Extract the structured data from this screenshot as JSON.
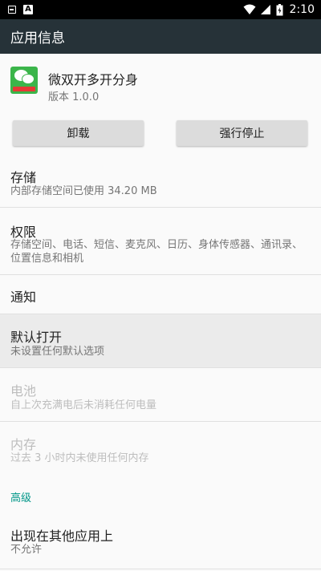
{
  "status_bar": {
    "time": "2:10",
    "icons": [
      "notification-icon",
      "font-icon",
      "wifi-icon",
      "signal-icon",
      "battery-icon"
    ]
  },
  "app_bar": {
    "title": "应用信息"
  },
  "app": {
    "name": "微双开多开分身",
    "version": "版本 1.0.0",
    "icon": "wechat-clone-icon"
  },
  "buttons": {
    "uninstall": "卸载",
    "force_stop": "强行停止"
  },
  "items": {
    "storage": {
      "title": "存储",
      "sub": "内部存储空间已使用 34.20 MB"
    },
    "permissions": {
      "title": "权限",
      "sub": "存储空间、电话、短信、麦克风、日历、身体传感器、通讯录、位置信息和相机"
    },
    "notifications": {
      "title": "通知"
    },
    "open_by_default": {
      "title": "默认打开",
      "sub": "未设置任何默认选项"
    },
    "battery": {
      "title": "电池",
      "sub": "自上次充满电后未消耗任何电量"
    },
    "memory": {
      "title": "内存",
      "sub": "过去 3 小时内未使用任何内存"
    }
  },
  "advanced": {
    "header": "高级",
    "draw_over": {
      "title": "出现在其他应用上",
      "sub": "不允许"
    }
  },
  "colors": {
    "app_bar": "#263238",
    "accent": "#009688",
    "button": "#dcdcdc"
  }
}
